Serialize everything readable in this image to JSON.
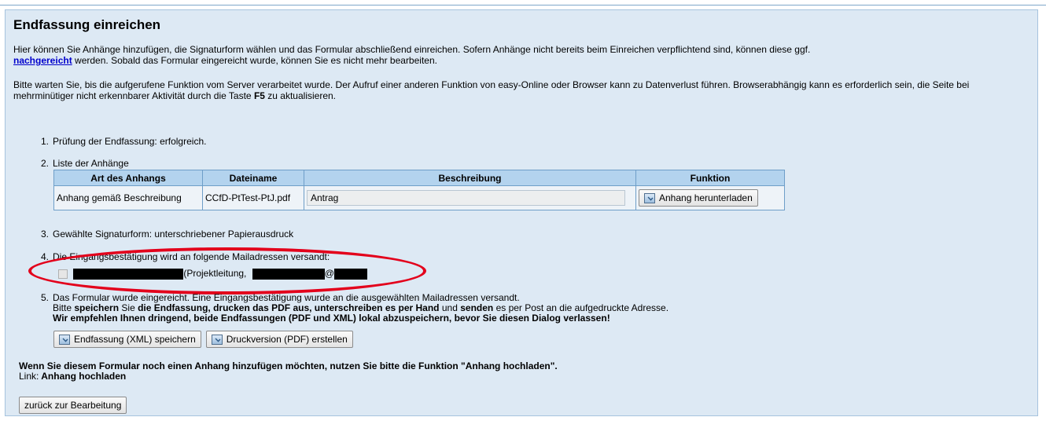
{
  "title": "Endfassung einreichen",
  "intro": {
    "part1": "Hier können Sie Anhänge hinzufügen, die Signaturform wählen und das Formular abschließend einreichen. Sofern Anhänge nicht bereits beim Einreichen verpflichtend sind, können diese ggf.",
    "link": "nachgereicht",
    "part2": " werden. Sobald das Formular eingereicht wurde, können Sie es nicht mehr bearbeiten."
  },
  "wait_notice": {
    "part1": "Bitte warten Sie, bis die aufgerufene Funktion vom Server verarbeitet wurde. Der Aufruf einer anderen Funktion von easy-Online oder Browser kann zu Datenverlust führen. Browserabhängig kann es erforderlich sein, die Seite bei mehrminütiger nicht erkennbarer Aktivität durch die Taste ",
    "key": "F5",
    "part2": " zu aktualisieren."
  },
  "steps": {
    "s1": {
      "num": "1.",
      "text": "Prüfung der Endfassung: erfolgreich."
    },
    "s2": {
      "num": "2.",
      "text": "Liste der Anhänge"
    },
    "s3": {
      "num": "3.",
      "text": "Gewählte Signaturform: unterschriebener Papierausdruck"
    },
    "s4": {
      "num": "4.",
      "text": "Die Eingangsbestätigung wird an folgende Mailadressen versandt:",
      "recipient_role": "(Projektleitung,",
      "at_sign": "@"
    },
    "s5": {
      "num": "5.",
      "line1": "Das Formular wurde eingereicht. Eine Eingangsbestätigung wurde an die ausgewählten Mailadressen versandt.",
      "line2_a": "Bitte ",
      "line2_b": "speichern",
      "line2_c": " Sie ",
      "line2_d": "die Endfassung, drucken das PDF aus, unterschreiben es per Hand",
      "line2_e": " und ",
      "line2_f": "senden",
      "line2_g": " es per Post an die aufgedruckte Adresse.",
      "line3": "Wir empfehlen Ihnen dringend, beide Endfassungen (PDF und XML) lokal abzuspeichern, bevor Sie diesen Dialog verlassen!",
      "btn_xml": "Endfassung (XML) speichern",
      "btn_pdf": "Druckversion (PDF) erstellen"
    }
  },
  "attachments_table": {
    "headers": [
      "Art des Anhangs",
      "Dateiname",
      "Beschreibung",
      "Funktion"
    ],
    "rows": [
      {
        "type": "Anhang gemäß Beschreibung",
        "filename": "CCfD-PtTest-PtJ.pdf",
        "description": "Antrag",
        "action": "Anhang herunterladen"
      }
    ]
  },
  "final_note": {
    "line1": "Wenn Sie diesem Formular noch einen Anhang hinzufügen möchten, nutzen Sie bitte die Funktion \"Anhang hochladen\".",
    "link_label": "Link:",
    "link_text": "Anhang hochladen"
  },
  "back_button": "zurück zur Bearbeitung",
  "colors": {
    "panel_bg": "#dde9f4",
    "table_header": "#b3d3ee",
    "highlight_ellipse": "#e3001b",
    "link": "#0000cc"
  },
  "icons": [
    "download-icon",
    "save-icon",
    "pdf-icon"
  ]
}
